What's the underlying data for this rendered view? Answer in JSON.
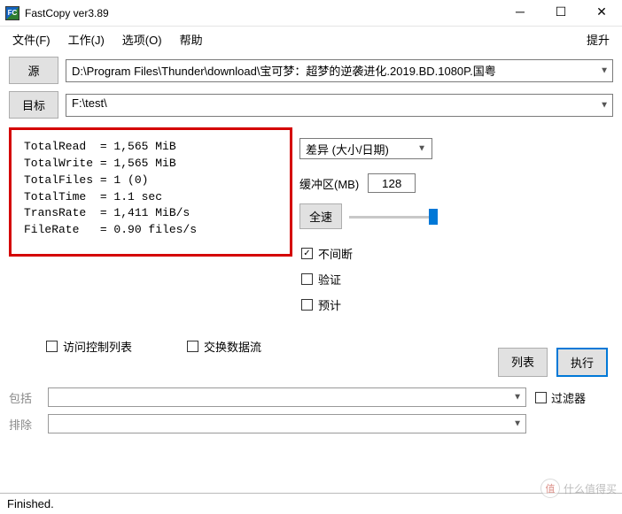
{
  "title": "FastCopy ver3.89",
  "menu": {
    "file": "文件(F)",
    "work": "工作(J)",
    "options": "选项(O)",
    "help": "帮助",
    "upgrade": "提升"
  },
  "source": {
    "btn": "源",
    "path": "D:\\Program Files\\Thunder\\download\\宝可梦：超梦的逆袭进化.2019.BD.1080P.国粤"
  },
  "dest": {
    "btn": "目标",
    "path": "F:\\test\\"
  },
  "stats": "TotalRead  = 1,565 MiB\nTotalWrite = 1,565 MiB\nTotalFiles = 1 (0)\nTotalTime  = 1.1 sec\nTransRate  = 1,411 MiB/s\nFileRate   = 0.90 files/s",
  "mode_label": "差异 (大小/日期)",
  "buffer": {
    "label": "缓冲区(MB)",
    "value": "128"
  },
  "fullspeed": "全速",
  "checks": {
    "nonstop": "不间断",
    "verify": "验证",
    "estimate": "预计"
  },
  "bottom": {
    "acl": "访问控制列表",
    "ads": "交换数据流"
  },
  "actions": {
    "list": "列表",
    "exec": "执行"
  },
  "filter": {
    "include_label": "包括",
    "exclude_label": "排除",
    "filter_label": "过滤器"
  },
  "status": "Finished.",
  "watermark": {
    "char": "值",
    "text": "什么值得买"
  }
}
